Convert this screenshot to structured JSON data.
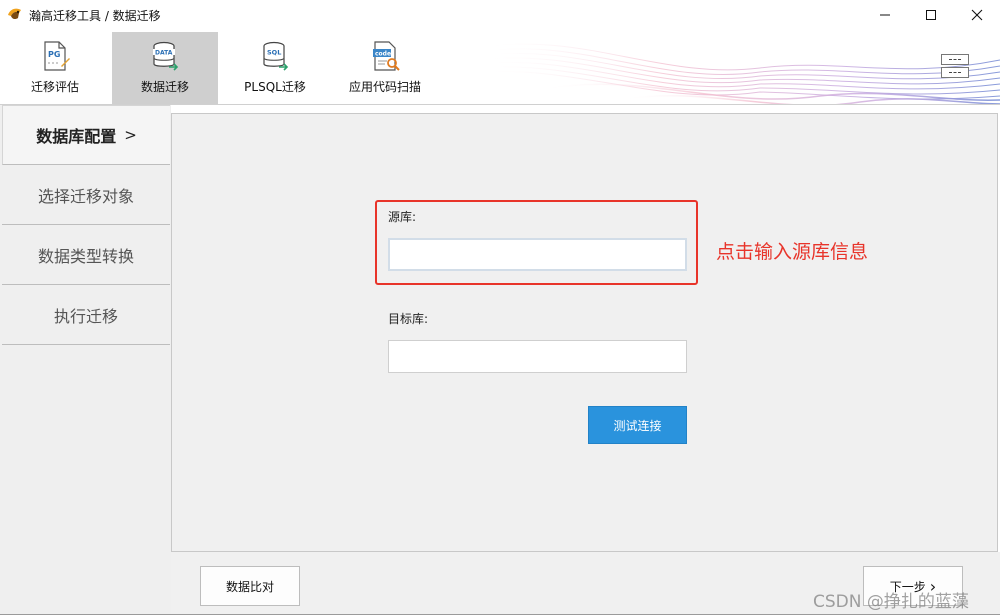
{
  "window": {
    "title": "瀚高迁移工具 / 数据迁移",
    "controls": {
      "minimize_icon": "minimize-icon",
      "maximize_icon": "maximize-icon",
      "close_icon": "close-icon"
    }
  },
  "toolbar": {
    "items": [
      {
        "label": "迁移评估",
        "icon": "pg-document-icon",
        "active": false
      },
      {
        "label": "数据迁移",
        "icon": "data-database-icon",
        "active": true
      },
      {
        "label": "PLSQL迁移",
        "icon": "sql-database-icon",
        "active": false
      },
      {
        "label": "应用代码扫描",
        "icon": "code-scan-icon",
        "active": false
      }
    ]
  },
  "sidebar": {
    "items": [
      {
        "label": "数据库配置",
        "arrow": ">",
        "active": true
      },
      {
        "label": "选择迁移对象",
        "active": false
      },
      {
        "label": "数据类型转换",
        "active": false
      },
      {
        "label": "执行迁移",
        "active": false
      }
    ]
  },
  "form": {
    "source_label": "源库:",
    "source_value": "",
    "target_label": "目标库:",
    "target_value": "",
    "test_button": "测试连接"
  },
  "annotation": {
    "text": "点击输入源库信息",
    "color": "#e8342a"
  },
  "footer": {
    "compare_button": "数据比对",
    "next_button": "下一步",
    "next_arrow": "›"
  },
  "watermark": "CSDN @挣扎的蓝藻",
  "colors": {
    "accent": "#2a93dd",
    "annotation": "#e8342a",
    "active_tab": "#cfcfcf"
  }
}
